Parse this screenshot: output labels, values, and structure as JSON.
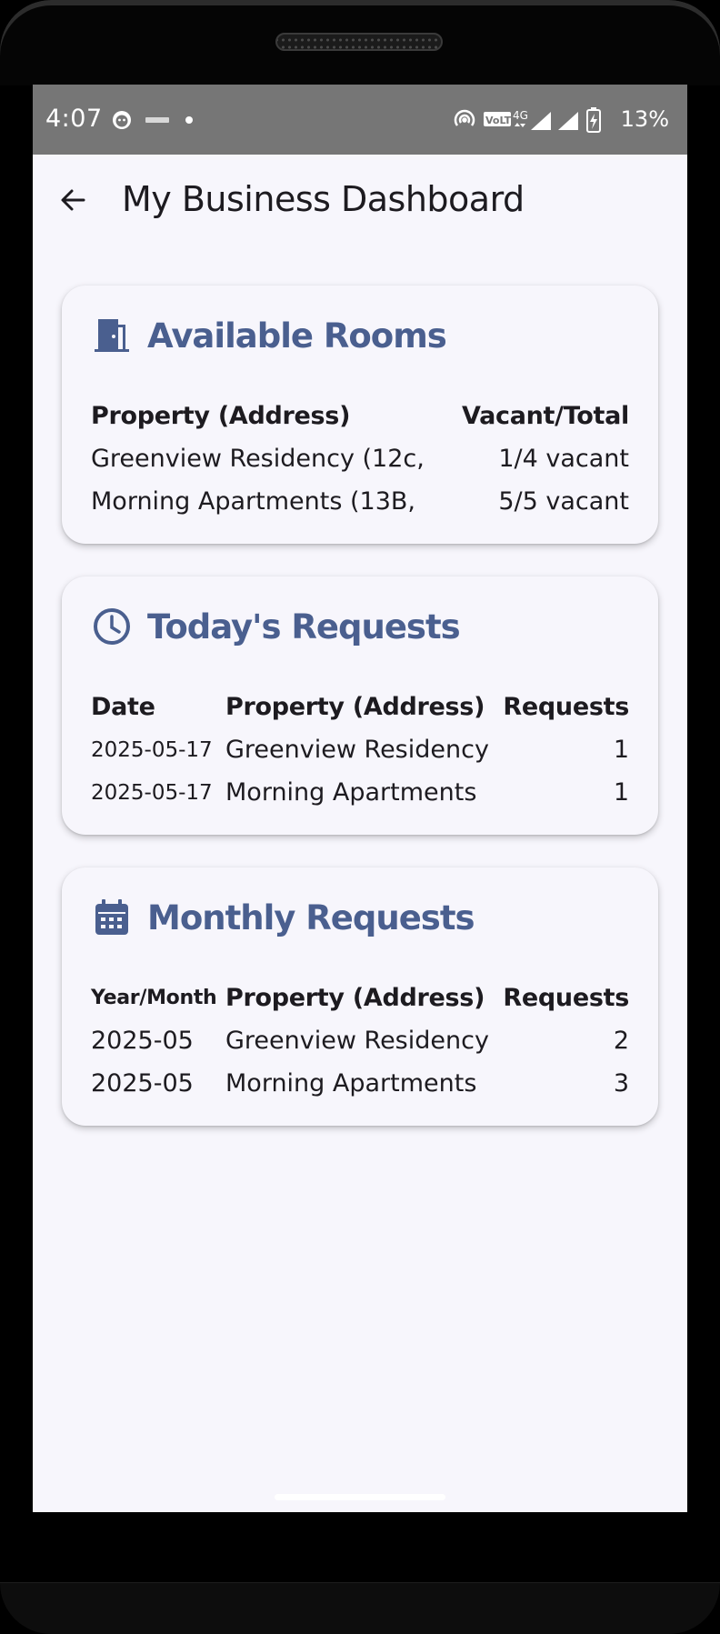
{
  "status_bar": {
    "time": "4:07",
    "battery": "13%",
    "network": "4G",
    "volte": "VoLTE"
  },
  "app_bar": {
    "title": "My Business Dashboard"
  },
  "available_rooms": {
    "title": "Available Rooms",
    "icon": "door-icon",
    "headers": [
      "Property (Address)",
      "Vacant/Total"
    ],
    "rows": [
      {
        "property": "Greenview Residency (12c,",
        "vacancy": "1/4 vacant"
      },
      {
        "property": "Morning Apartments (13B,",
        "vacancy": "5/5 vacant"
      }
    ]
  },
  "todays_requests": {
    "title": "Today's Requests",
    "icon": "clock-icon",
    "headers": [
      "Date",
      "Property (Address)",
      "Requests"
    ],
    "rows": [
      {
        "date": "2025-05-17",
        "property": "Greenview Residency",
        "requests": "1"
      },
      {
        "date": "2025-05-17",
        "property": "Morning Apartments",
        "requests": "1"
      }
    ]
  },
  "monthly_requests": {
    "title": "Monthly Requests",
    "icon": "calendar-icon",
    "headers": [
      "Year/Month",
      "Property (Address)",
      "Requests"
    ],
    "rows": [
      {
        "month": "2025-05",
        "property": "Greenview Residency",
        "requests": "2"
      },
      {
        "month": "2025-05",
        "property": "Morning Apartments",
        "requests": "3"
      }
    ]
  },
  "colors": {
    "accent": "#4a5f8f",
    "screen_bg": "#f7f6fc",
    "status_bar_bg": "#767676",
    "text": "#1d1b20"
  }
}
